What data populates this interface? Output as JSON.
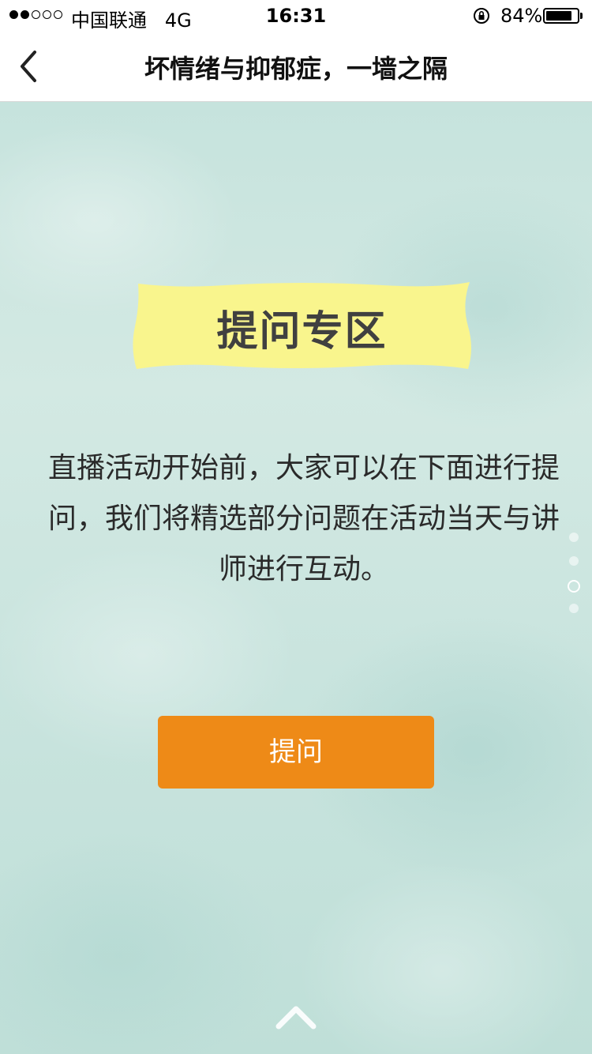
{
  "status_bar": {
    "carrier": "中国联通",
    "network": "4G",
    "time": "16:31",
    "battery_percent": "84%",
    "battery_level": 0.84,
    "signal_bars_filled": 2,
    "signal_bars_total": 5
  },
  "nav": {
    "title": "坏情绪与抑郁症，一墙之隔",
    "back_icon": "chevron-left-icon"
  },
  "banner": {
    "title": "提问专区",
    "color": "#f9f58d"
  },
  "intro": {
    "text": "直播活动开始前，大家可以在下面进行提问，我们将精选部分问题在活动当天与讲师进行互动。"
  },
  "ask_button": {
    "label": "提问",
    "color": "#ee8a17"
  },
  "page_indicator": {
    "total": 4,
    "active_index": 2
  },
  "scroll_hint": {
    "icon": "chevron-up-icon"
  }
}
